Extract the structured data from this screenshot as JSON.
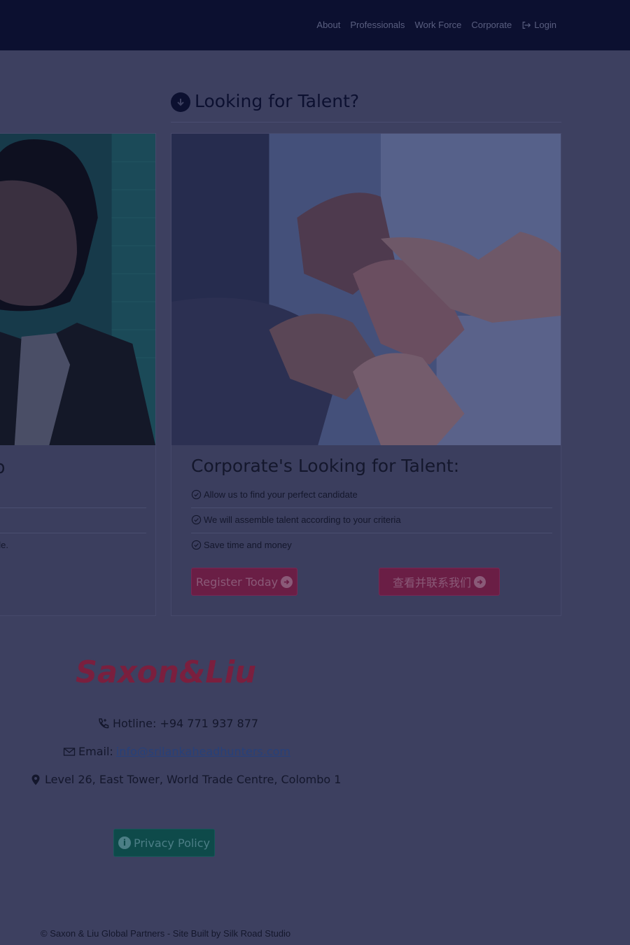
{
  "nav": {
    "items": [
      {
        "label": "About",
        "icon": ""
      },
      {
        "label": "Professionals",
        "icon": ""
      },
      {
        "label": "Work Force",
        "icon": ""
      },
      {
        "label": "Corporate",
        "icon": ""
      },
      {
        "label": "Login",
        "icon": "login-icon"
      }
    ]
  },
  "talent_section": {
    "heading": "Looking for Talent?",
    "heading_icon": "arrow-down-circle-icon"
  },
  "left_card": {
    "title_fragment": "b",
    "text_fragment": "ple."
  },
  "right_card": {
    "title": "Corporate's Looking for Talent:",
    "features": [
      "Allow us to find your perfect candidate",
      "We will assemble talent according to your criteria",
      "Save time and money"
    ],
    "feature_icon": "check-circle-icon",
    "register_button": "Register Today",
    "contact_button": "查看并联系我们",
    "button_icon": "arrow-right-circle-icon"
  },
  "footer": {
    "logo_text": "Saxon&Liu",
    "hotline_label": "Hotline: +94 771 937 877",
    "email_label": "Email: ",
    "email": "info@srilankaheadhunters.com",
    "address": "Level 26, East Tower, World Trade Centre, Colombo 1",
    "privacy_button": "Privacy Policy",
    "copyright": "© Saxon & Liu Global Partners - Site Built by Silk Road Studio"
  },
  "colors": {
    "navbar": "#0c1030",
    "overlay": "#3d4060",
    "accent_red": "#6a1e45",
    "accent_teal": "#0e4a4a",
    "logo": "#7a1f3e"
  }
}
